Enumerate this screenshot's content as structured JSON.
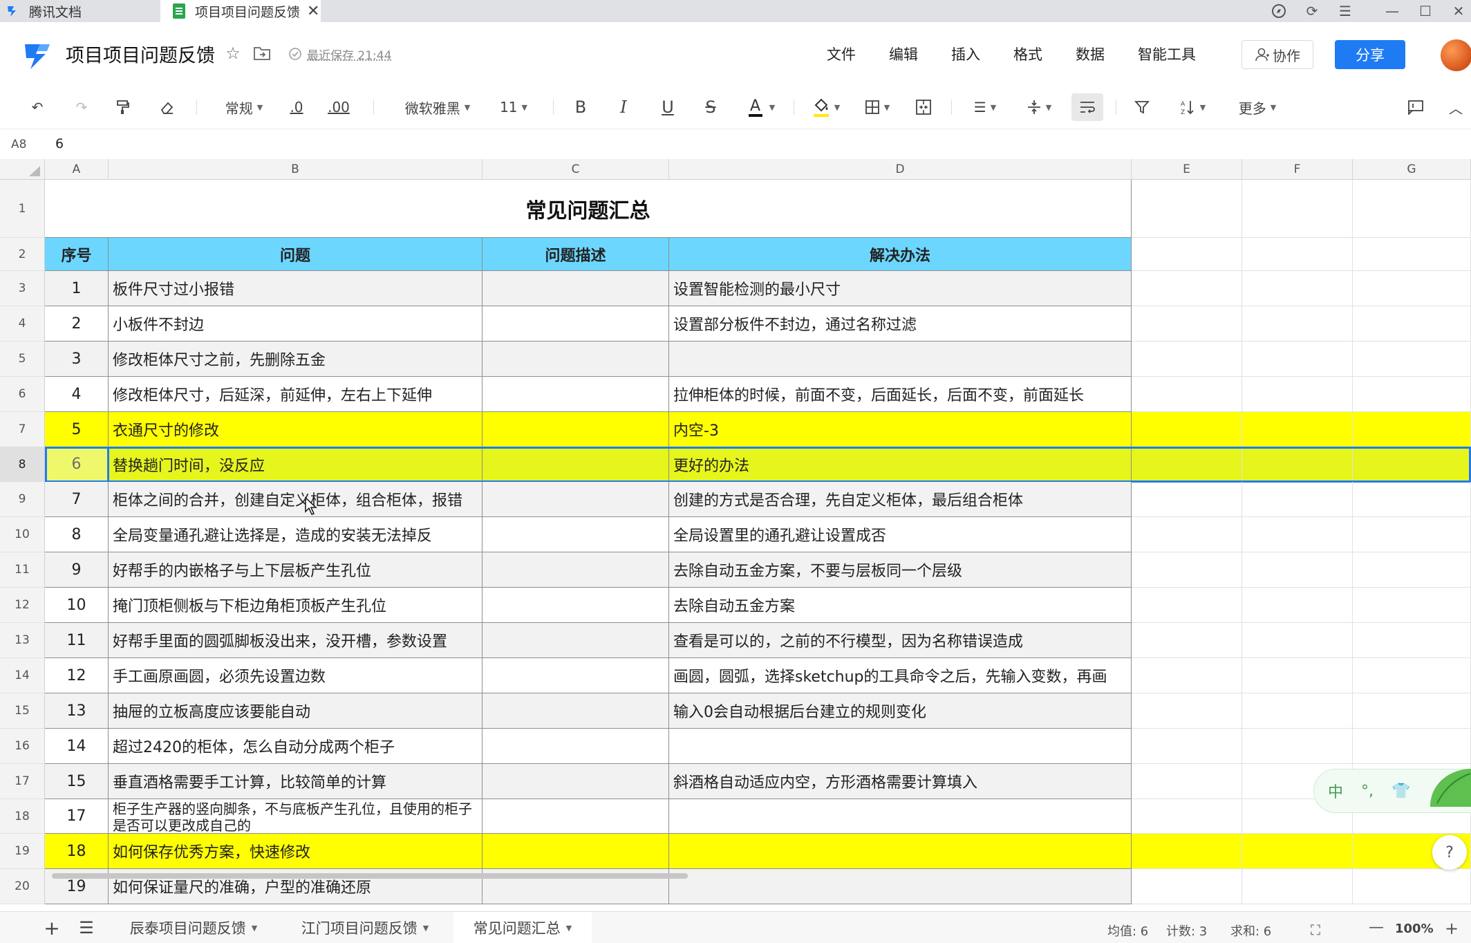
{
  "tabs": [
    {
      "label": "腾讯文档"
    },
    {
      "label": "项目项目问题反馈"
    }
  ],
  "header": {
    "doc_title": "项目项目问题反馈",
    "save_status": "最近保存 21:44",
    "menu": [
      "文件",
      "编辑",
      "插入",
      "格式",
      "数据",
      "智能工具"
    ],
    "collab_label": "协作",
    "share_label": "分享"
  },
  "toolbar": {
    "number_format": "常规",
    "dec_decrease": ".0",
    "dec_increase": ".00",
    "font_family": "微软雅黑",
    "font_size": "11",
    "more_label": "更多"
  },
  "formula_bar": {
    "cell_ref": "A8",
    "value": "6"
  },
  "columns": [
    "A",
    "B",
    "C",
    "D",
    "E",
    "F",
    "G"
  ],
  "sheet": {
    "title": "常见问题汇总",
    "headers": [
      "序号",
      "问题",
      "问题描述",
      "解决办法"
    ],
    "rows": [
      {
        "row": "3",
        "no": "1",
        "problem": "板件尺寸过小报错",
        "desc": "",
        "solution": "设置智能检测的最小尺寸",
        "style": "gray"
      },
      {
        "row": "4",
        "no": "2",
        "problem": "小板件不封边",
        "desc": "",
        "solution": "设置部分板件不封边，通过名称过滤",
        "style": "plain"
      },
      {
        "row": "5",
        "no": "3",
        "problem": "修改柜体尺寸之前，先删除五金",
        "desc": "",
        "solution": "",
        "style": "gray"
      },
      {
        "row": "6",
        "no": "4",
        "problem": "修改柜体尺寸，后延深，前延伸，左右上下延伸",
        "desc": "",
        "solution": "拉伸柜体的时候，前面不变，后面延长，后面不变，前面延长",
        "style": "plain"
      },
      {
        "row": "7",
        "no": "5",
        "problem": "衣通尺寸的修改",
        "desc": "",
        "solution": "内空-3",
        "style": "yellow"
      },
      {
        "row": "8",
        "no": "6",
        "problem": "替换趟门时间，没反应",
        "desc": "",
        "solution": "更好的办法",
        "style": "sel"
      },
      {
        "row": "9",
        "no": "7",
        "problem": "柜体之间的合并，创建自定义柜体，组合柜体，报错",
        "desc": "",
        "solution": "创建的方式是否合理，先自定义柜体，最后组合柜体",
        "style": "gray"
      },
      {
        "row": "10",
        "no": "8",
        "problem": "全局变量通孔避让选择是，造成的安装无法掉反",
        "desc": "",
        "solution": "全局设置里的通孔避让设置成否",
        "style": "plain"
      },
      {
        "row": "11",
        "no": "9",
        "problem": "好帮手的内嵌格子与上下层板产生孔位",
        "desc": "",
        "solution": "去除自动五金方案，不要与层板同一个层级",
        "style": "gray"
      },
      {
        "row": "12",
        "no": "10",
        "problem": "掩门顶柜侧板与下柜边角柜顶板产生孔位",
        "desc": "",
        "solution": "去除自动五金方案",
        "style": "plain"
      },
      {
        "row": "13",
        "no": "11",
        "problem": "好帮手里面的圆弧脚板没出来，没开槽，参数设置",
        "desc": "",
        "solution": "查看是可以的，之前的不行模型，因为名称错误造成",
        "style": "gray"
      },
      {
        "row": "14",
        "no": "12",
        "problem": "手工画原画圆，必须先设置边数",
        "desc": "",
        "solution": "画圆，圆弧，选择sketchup的工具命令之后，先输入变数，再画",
        "style": "plain"
      },
      {
        "row": "15",
        "no": "13",
        "problem": "抽屉的立板高度应该要能自动",
        "desc": "",
        "solution": "输入0会自动根据后台建立的规则变化",
        "style": "gray"
      },
      {
        "row": "16",
        "no": "14",
        "problem": "超过2420的柜体，怎么自动分成两个柜子",
        "desc": "",
        "solution": "",
        "style": "plain"
      },
      {
        "row": "17",
        "no": "15",
        "problem": "垂直酒格需要手工计算，比较简单的计算",
        "desc": "",
        "solution": "斜酒格自动适应内空，方形酒格需要计算填入",
        "style": "gray"
      },
      {
        "row": "18",
        "no": "17",
        "problem": "柜子生产器的竖向脚条，不与底板产生孔位，且使用的柜子是否可以更改成自己的",
        "desc": "",
        "solution": "",
        "style": "plain"
      },
      {
        "row": "19",
        "no": "18",
        "problem": "如何保存优秀方案，快速修改",
        "desc": "",
        "solution": "",
        "style": "yellow"
      },
      {
        "row": "20",
        "no": "19",
        "problem": "如何保证量尺的准确，户型的准确还原",
        "desc": "",
        "solution": "",
        "style": "gray"
      }
    ]
  },
  "row_numbers": [
    "1",
    "2"
  ],
  "sheet_tabs": [
    "辰泰项目问题反馈",
    "江门项目问题反馈",
    "常见问题汇总"
  ],
  "status": {
    "avg": "均值: 6",
    "count": "计数: 3",
    "sum": "求和: 6",
    "zoom": "100%"
  },
  "ime": {
    "label": "中"
  },
  "help": {
    "label": "?"
  },
  "colors": {
    "header_fill": "#6cd6ff",
    "highlight": "#ffff00",
    "selected_row": "#e6f51c",
    "accent": "#1e7bf4"
  }
}
